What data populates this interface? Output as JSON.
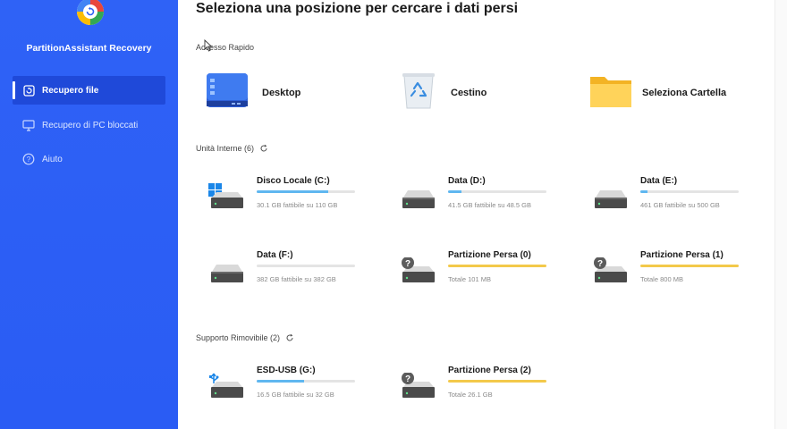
{
  "app": {
    "name": "PartitionAssistant Recovery"
  },
  "sidebar": {
    "items": [
      {
        "label": "Recupero file",
        "icon": "restore-file-icon",
        "active": true
      },
      {
        "label": "Recupero di PC bloccati",
        "icon": "monitor-icon",
        "active": false
      },
      {
        "label": "Aiuto",
        "icon": "help-icon",
        "active": false
      }
    ]
  },
  "main": {
    "title": "Seleziona una posizione per cercare i dati persi",
    "quick_access": {
      "title": "Accesso Rapido",
      "items": [
        {
          "label": "Desktop",
          "icon": "desktop-icon"
        },
        {
          "label": "Cestino",
          "icon": "recycle-bin-icon"
        },
        {
          "label": "Seleziona Cartella",
          "icon": "folder-icon"
        }
      ]
    },
    "internal": {
      "title": "Unità Interne (6)",
      "drives": [
        {
          "name": "Disco Locale (C:)",
          "size": "30.1 GB fattibile su 110 GB",
          "used_fraction": 0.73,
          "kind": "windows"
        },
        {
          "name": "Data (D:)",
          "size": "41.5 GB fattibile su 48.5 GB",
          "used_fraction": 0.14,
          "kind": "disk"
        },
        {
          "name": "Data (E:)",
          "size": "461 GB fattibile su 500 GB",
          "used_fraction": 0.07,
          "kind": "disk"
        },
        {
          "name": "Data (F:)",
          "size": "382 GB fattibile su 382 GB",
          "used_fraction": 0.0,
          "kind": "disk"
        },
        {
          "name": "Partizione Persa (0)",
          "size": "Totale 101 MB",
          "used_fraction": 1.0,
          "kind": "lost"
        },
        {
          "name": "Partizione Persa (1)",
          "size": "Totale 800 MB",
          "used_fraction": 1.0,
          "kind": "lost"
        }
      ]
    },
    "removable": {
      "title": "Supporto Rimovibile (2)",
      "drives": [
        {
          "name": "ESD-USB (G:)",
          "size": "16.5 GB fattibile su 32 GB",
          "used_fraction": 0.48,
          "kind": "usb"
        },
        {
          "name": "Partizione Persa (2)",
          "size": "Totale 26.1 GB",
          "used_fraction": 1.0,
          "kind": "lost"
        }
      ]
    }
  },
  "colors": {
    "sidebar": "#2f62f6",
    "sidebar_active": "#1f49d9",
    "bar_blue": "#5fb7f0",
    "bar_yellow": "#f3c94a"
  }
}
